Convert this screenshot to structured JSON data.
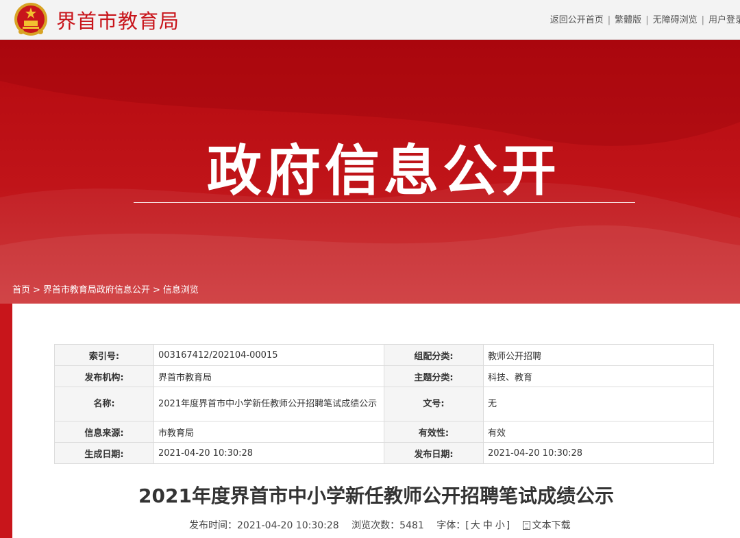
{
  "header": {
    "site_name": "界首市教育局",
    "links": [
      "返回公开首页",
      "繁體版",
      "无障碍浏览",
      "用户登录"
    ],
    "separator": "|"
  },
  "banner": {
    "title": "政府信息公开"
  },
  "breadcrumb": {
    "items": [
      "首页",
      "界首市教育局政府信息公开",
      "信息浏览"
    ],
    "separator": ">"
  },
  "meta": {
    "rows": [
      {
        "l1": "索引号:",
        "v1": "003167412/202104-00015",
        "l2": "组配分类:",
        "v2": "教师公开招聘"
      },
      {
        "l1": "发布机构:",
        "v1": "界首市教育局",
        "l2": "主题分类:",
        "v2": "科技、教育"
      },
      {
        "l1": "名称:",
        "v1": "2021年度界首市中小学新任教师公开招聘笔试成绩公示",
        "l2": "文号:",
        "v2": "无"
      },
      {
        "l1": "信息来源:",
        "v1": "市教育局",
        "l2": "有效性:",
        "v2": "有效"
      },
      {
        "l1": "生成日期:",
        "v1": "2021-04-20 10:30:28",
        "l2": "发布日期:",
        "v2": "2021-04-20 10:30:28"
      }
    ]
  },
  "article": {
    "title": "2021年度界首市中小学新任教师公开招聘笔试成绩公示",
    "publish_time": "发布时间：2021-04-20 10:30:28",
    "views": "浏览次数：5481",
    "font_label": "字体：[",
    "font_large": "大",
    "font_medium": "中",
    "font_small": "小",
    "font_close": "]",
    "download": "文本下载"
  },
  "colors": {
    "brand_red": "#c8151b",
    "text": "#333333"
  },
  "icons": {
    "emblem": "national-emblem-icon",
    "download": "document-icon"
  }
}
